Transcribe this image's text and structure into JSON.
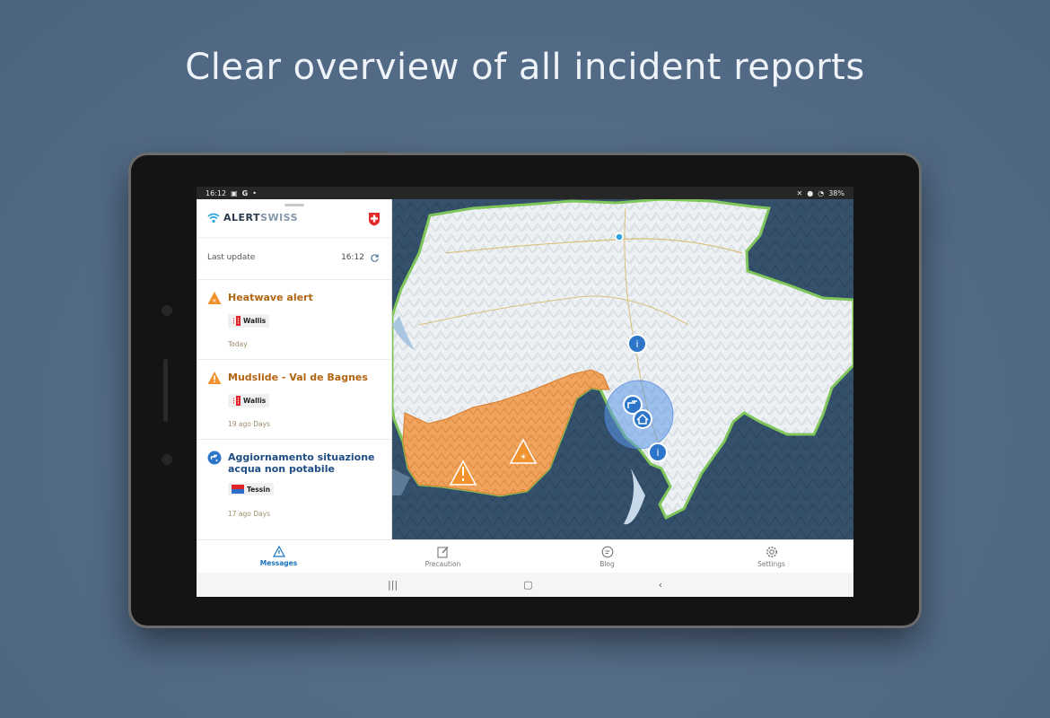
{
  "headline": "Clear overview of all incident reports",
  "status": {
    "time": "16:12",
    "battery": "38%"
  },
  "app": {
    "brand": "ALERT",
    "brand2": "SWISS"
  },
  "panel": {
    "last_update_label": "Last update",
    "last_update_time": "16:12"
  },
  "messages": [
    {
      "title": "Heatwave alert",
      "region": "Wallis",
      "time": "Today",
      "kind": "heat"
    },
    {
      "title": "Mudslide - Val de Bagnes",
      "region": "Wallis",
      "time": "19 ago Days",
      "kind": "warning"
    },
    {
      "title": "Aggiornamento situazione acqua non potabile",
      "region": "Tessin",
      "time": "17 ago Days",
      "kind": "info"
    }
  ],
  "nav": {
    "messages": "Messages",
    "precaution": "Precaution",
    "blog": "Blog",
    "settings": "Settings"
  },
  "colors": {
    "accent": "#1a74c2",
    "warning": "#f0922e",
    "region_fill": "#f2a25a",
    "info": "#2d75c8"
  }
}
